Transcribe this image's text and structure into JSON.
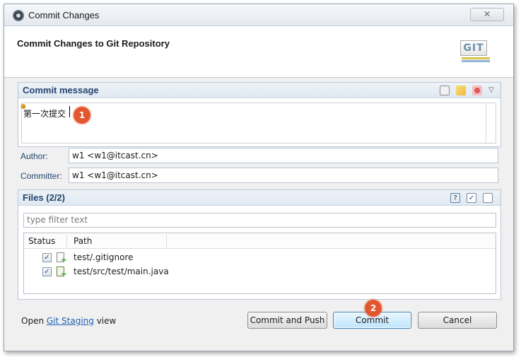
{
  "window": {
    "title": "Commit Changes",
    "close_symbol": "✕"
  },
  "header": {
    "title": "Commit Changes to Git Repository",
    "logo_text": "GIT"
  },
  "commit_message": {
    "section_title": "Commit message",
    "text": "第一次提交",
    "toolbar_icons": [
      "history-icon",
      "spellcheck-icon",
      "sign-off-icon",
      "menu-icon"
    ]
  },
  "author": {
    "label": "Author:",
    "value": "w1 <w1@itcast.cn>"
  },
  "committer": {
    "label": "Committer:",
    "value": "w1 <w1@itcast.cn>"
  },
  "files": {
    "section_title": "Files (2/2)",
    "filter_placeholder": "type filter text",
    "columns": [
      "Status",
      "Path"
    ],
    "rows": [
      {
        "checked": true,
        "path": "test/.gitignore"
      },
      {
        "checked": true,
        "path": "test/src/test/main.java"
      }
    ]
  },
  "footer": {
    "prefix": "Open ",
    "link": "Git Staging",
    "suffix": " view"
  },
  "buttons": {
    "commit_and_push": "Commit and Push",
    "commit": "Commit",
    "cancel": "Cancel"
  },
  "annotations": {
    "badge1": "1",
    "badge2": "2"
  },
  "colors": {
    "accent": "#25446e",
    "badge": "#e2572f",
    "link": "#1f5fb3"
  }
}
